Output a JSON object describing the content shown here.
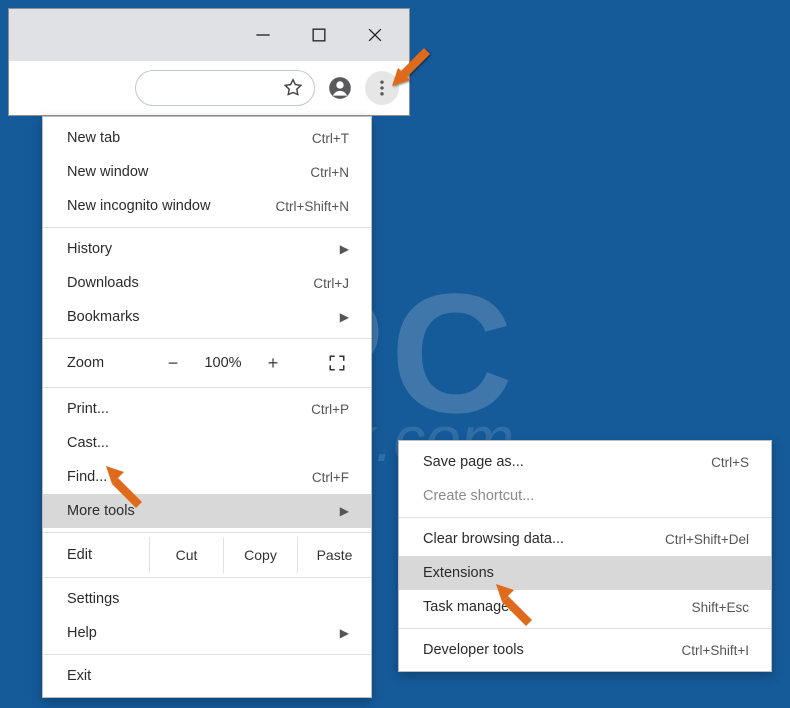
{
  "window": {
    "controls": {
      "min": "−",
      "max": "☐",
      "close": "×"
    }
  },
  "toolbar": {
    "star": "☆",
    "profile": "●",
    "more": "⋮"
  },
  "menu": {
    "new_tab": {
      "label": "New tab",
      "shortcut": "Ctrl+T"
    },
    "new_window": {
      "label": "New window",
      "shortcut": "Ctrl+N"
    },
    "new_incognito": {
      "label": "New incognito window",
      "shortcut": "Ctrl+Shift+N"
    },
    "history": {
      "label": "History"
    },
    "downloads": {
      "label": "Downloads",
      "shortcut": "Ctrl+J"
    },
    "bookmarks": {
      "label": "Bookmarks"
    },
    "zoom": {
      "label": "Zoom",
      "minus": "−",
      "value": "100%",
      "plus": "+"
    },
    "print": {
      "label": "Print...",
      "shortcut": "Ctrl+P"
    },
    "cast": {
      "label": "Cast..."
    },
    "find": {
      "label": "Find...",
      "shortcut": "Ctrl+F"
    },
    "more_tools": {
      "label": "More tools"
    },
    "edit": {
      "label": "Edit",
      "cut": "Cut",
      "copy": "Copy",
      "paste": "Paste"
    },
    "settings": {
      "label": "Settings"
    },
    "help": {
      "label": "Help"
    },
    "exit": {
      "label": "Exit"
    }
  },
  "submenu": {
    "save_page": {
      "label": "Save page as...",
      "shortcut": "Ctrl+S"
    },
    "create_shortcut": {
      "label": "Create shortcut..."
    },
    "clear_data": {
      "label": "Clear browsing data...",
      "shortcut": "Ctrl+Shift+Del"
    },
    "extensions": {
      "label": "Extensions"
    },
    "task_manager": {
      "label": "Task manager",
      "shortcut": "Shift+Esc"
    },
    "dev_tools": {
      "label": "Developer tools",
      "shortcut": "Ctrl+Shift+I"
    }
  }
}
